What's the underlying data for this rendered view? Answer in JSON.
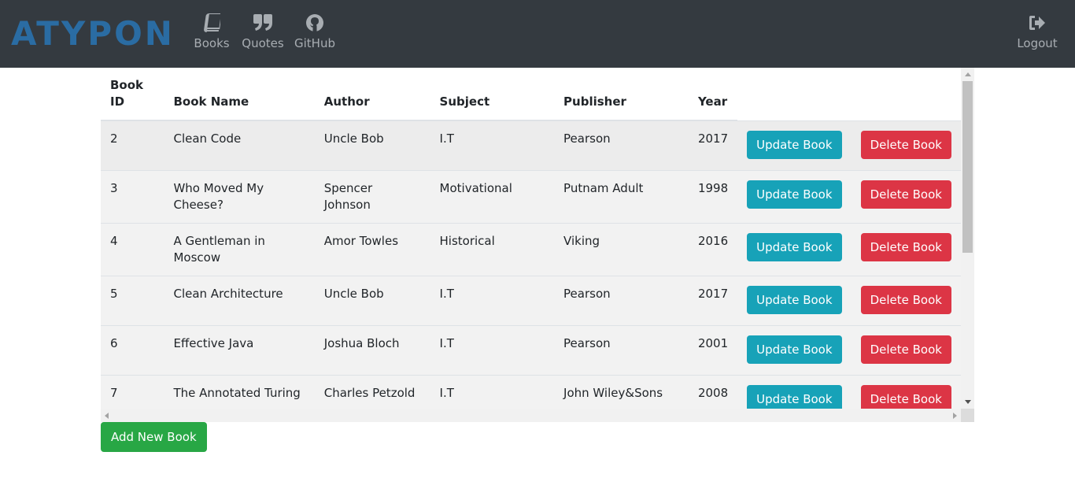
{
  "brand": {
    "logo_text": "ATYPON",
    "color": "#2a6ca3"
  },
  "nav": {
    "items": [
      {
        "label": "Books",
        "icon": "book-icon"
      },
      {
        "label": "Quotes",
        "icon": "quote-icon"
      },
      {
        "label": "GitHub",
        "icon": "github-icon"
      }
    ],
    "logout": {
      "label": "Logout",
      "icon": "sign-out-icon"
    }
  },
  "table": {
    "headers": {
      "id_line1": "Book",
      "id_line2": "ID",
      "name": "Book Name",
      "author": "Author",
      "subject": "Subject",
      "publisher": "Publisher",
      "year": "Year"
    },
    "update_label": "Update Book",
    "delete_label": "Delete Book",
    "rows": [
      {
        "id": "2",
        "name": "Clean Code",
        "author": "Uncle Bob",
        "subject": "I.T",
        "publisher": "Pearson",
        "year": "2017"
      },
      {
        "id": "3",
        "name": "Who Moved My Cheese?",
        "author": "Spencer Johnson",
        "subject": "Motivational",
        "publisher": "Putnam Adult",
        "year": "1998"
      },
      {
        "id": "4",
        "name": "A Gentleman in Moscow",
        "author": "Amor Towles",
        "subject": "Historical",
        "publisher": "Viking",
        "year": "2016"
      },
      {
        "id": "5",
        "name": "Clean Architecture",
        "author": "Uncle Bob",
        "subject": "I.T",
        "publisher": "Pearson",
        "year": "2017"
      },
      {
        "id": "6",
        "name": "Effective Java",
        "author": "Joshua Bloch",
        "subject": "I.T",
        "publisher": "Pearson",
        "year": "2001"
      },
      {
        "id": "7",
        "name": "The Annotated Turing",
        "author": "Charles Petzold",
        "subject": "I.T",
        "publisher": "John Wiley&Sons",
        "year": "2008"
      }
    ]
  },
  "add_button_label": "Add New Book",
  "colors": {
    "navbar": "#343a40",
    "info": "#17a2b8",
    "danger": "#dc3545",
    "success": "#28a745"
  }
}
